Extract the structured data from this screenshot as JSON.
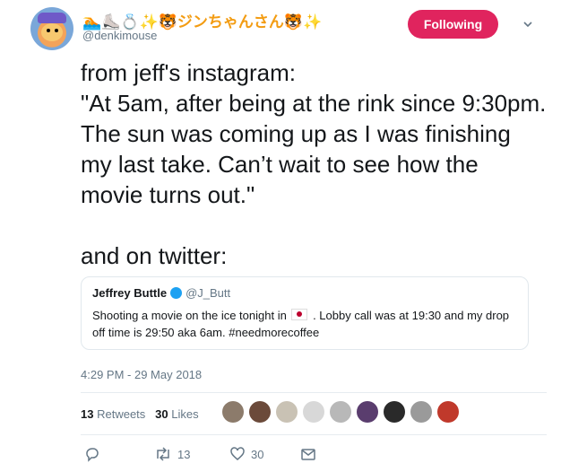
{
  "author": {
    "display_name": "🏊‍⛸💍✨🐯ジンちゃんさん🐯✨",
    "handle": "@denkimouse"
  },
  "follow_button": {
    "label": "Following"
  },
  "tweet": {
    "text": "from jeff's instagram:\n\"At  5am, after being at the rink since 9:30pm.  The sun was coming up as I was finishing my last take.  Can’t wait to see how the movie turns out.\"\n\nand on twitter:",
    "timestamp": "4:29 PM - 29 May 2018"
  },
  "quoted_tweet": {
    "name": "Jeffrey Buttle",
    "handle": "@J_Butt",
    "text_before_flag": "Shooting a movie on the ice tonight in",
    "text_after_flag": ".  Lobby call was at 19:30 and my drop off time is 29:50 aka 6am.  #needmorecoffee"
  },
  "stats": {
    "retweets_count": "13",
    "retweets_label": "Retweets",
    "likes_count": "30",
    "likes_label": "Likes"
  },
  "actions": {
    "reply_count": "",
    "retweet_count": "13",
    "like_count": "30"
  },
  "colors": {
    "follow_button": "#e0245e",
    "verified": "#1da1f2",
    "muted_text": "#657786"
  },
  "icons": [
    "chevron-down-icon",
    "verified-badge-icon",
    "japan-flag-icon",
    "reply-icon",
    "retweet-icon",
    "heart-icon",
    "envelope-icon"
  ]
}
